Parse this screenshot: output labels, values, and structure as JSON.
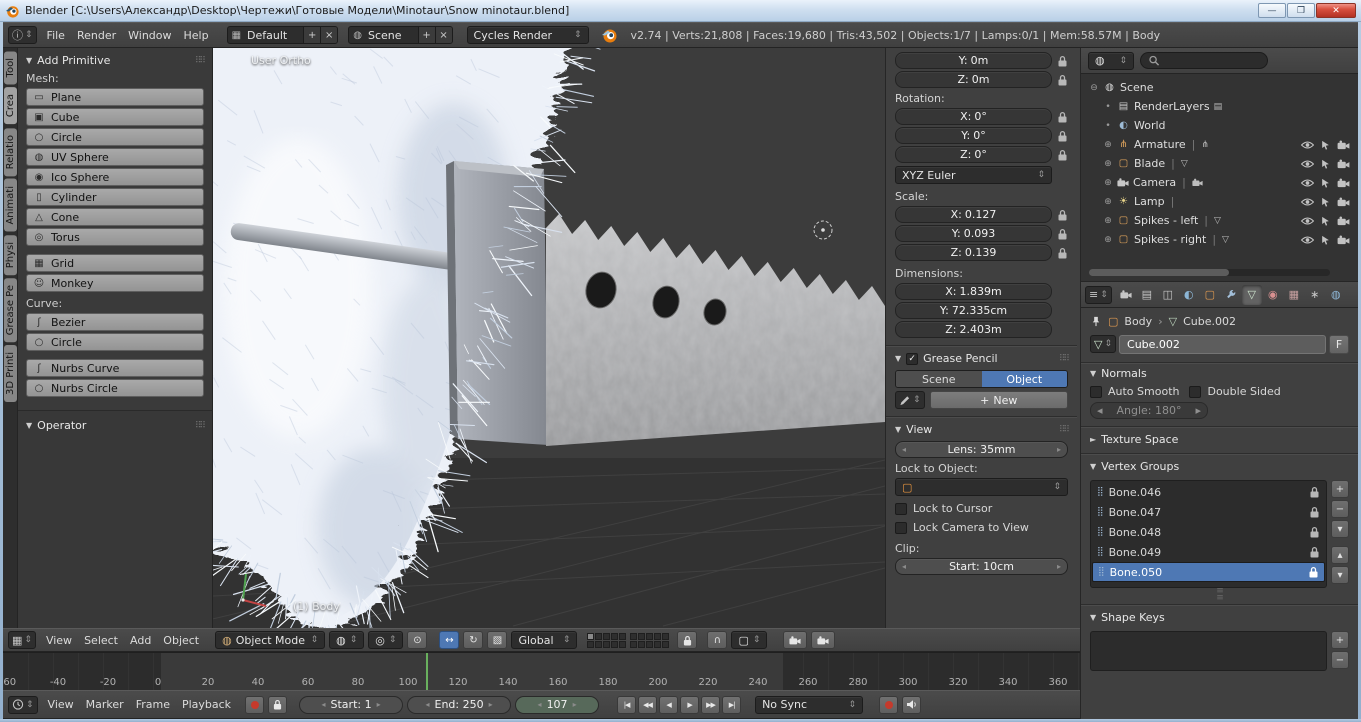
{
  "colors": {
    "accent": "#4e78b4",
    "green": "#69b05e",
    "red": "#c53a2c",
    "orange": "#e87d0d"
  },
  "window": {
    "title": "Blender [C:\\Users\\Александр\\Desktop\\Чертежи\\Готовые Модели\\Minotaur\\Snow minotaur.blend]"
  },
  "infobar": {
    "menus": [
      "File",
      "Render",
      "Window",
      "Help"
    ],
    "screen_name": "Default",
    "scene_name": "Scene",
    "engine": "Cycles Render",
    "stats": "v2.74 | Verts:21,808 | Faces:19,680 | Tris:43,502 | Objects:1/7 | Lamps:0/1 | Mem:58.57M | Body"
  },
  "toolshelf": {
    "tabs": [
      {
        "label": "Tool",
        "active": false
      },
      {
        "label": "Crea",
        "active": true
      },
      {
        "label": "Relatio",
        "active": false
      },
      {
        "label": "Animati",
        "active": false
      },
      {
        "label": "Physi",
        "active": false
      },
      {
        "label": "Grease Pe",
        "active": false
      },
      {
        "label": "3D Printi",
        "active": false
      }
    ],
    "panel_title": "Add Primitive",
    "mesh_label": "Mesh:",
    "mesh_buttons": [
      {
        "icon": "▭",
        "label": "Plane"
      },
      {
        "icon": "▣",
        "label": "Cube"
      },
      {
        "icon": "○",
        "label": "Circle"
      },
      {
        "icon": "◍",
        "label": "UV Sphere"
      },
      {
        "icon": "◉",
        "label": "Ico Sphere"
      },
      {
        "icon": "▯",
        "label": "Cylinder"
      },
      {
        "icon": "△",
        "label": "Cone"
      },
      {
        "icon": "◎",
        "label": "Torus"
      }
    ],
    "mesh_buttons2": [
      {
        "icon": "▦",
        "label": "Grid"
      },
      {
        "icon": "☺",
        "label": "Monkey"
      }
    ],
    "curve_label": "Curve:",
    "curve_buttons": [
      {
        "icon": "ʃ",
        "label": "Bezier"
      },
      {
        "icon": "○",
        "label": "Circle"
      }
    ],
    "curve_buttons2": [
      {
        "icon": "ʃ",
        "label": "Nurbs Curve"
      },
      {
        "icon": "○",
        "label": "Nurbs Circle"
      }
    ],
    "operator_title": "Operator"
  },
  "viewport": {
    "view_label": "User Ortho",
    "object_label": "(1) Body"
  },
  "npanel": {
    "loc_fields": [
      {
        "label": "Y:",
        "value": "0m"
      },
      {
        "label": "Z:",
        "value": "0m"
      }
    ],
    "rotation_label": "Rotation:",
    "rot_fields": [
      {
        "label": "X:",
        "value": "0°"
      },
      {
        "label": "Y:",
        "value": "0°"
      },
      {
        "label": "Z:",
        "value": "0°"
      }
    ],
    "rotation_mode": "XYZ Euler",
    "scale_label": "Scale:",
    "scale_fields": [
      {
        "label": "X:",
        "value": "0.127"
      },
      {
        "label": "Y:",
        "value": "0.093"
      },
      {
        "label": "Z:",
        "value": "0.139"
      }
    ],
    "dimensions_label": "Dimensions:",
    "dim_fields": [
      {
        "label": "X:",
        "value": "1.839m"
      },
      {
        "label": "Y:",
        "value": "72.335cm"
      },
      {
        "label": "Z:",
        "value": "2.403m"
      }
    ],
    "grease_title": "Grease Pencil",
    "gp_scene": "Scene",
    "gp_object": "Object",
    "gp_new": "New",
    "view_title": "View",
    "lens_label": "Lens:",
    "lens_value": "35mm",
    "lock_object_label": "Lock to Object:",
    "lock_cursor_label": "Lock to Cursor",
    "lock_camera_label": "Lock Camera to View",
    "clip_label": "Clip:",
    "clip_start_label": "Start:",
    "clip_start_value": "10cm"
  },
  "outliner": {
    "scene_label": "Scene",
    "items": [
      {
        "name": "RenderLayers",
        "icon": "layers_img",
        "color": "#cccccc",
        "expand": false,
        "pipe": false,
        "badge": "layers_img",
        "object": false
      },
      {
        "name": "World",
        "icon": "world",
        "color": "#9dbbd6",
        "expand": false,
        "pipe": false,
        "badge": "",
        "object": false
      },
      {
        "name": "Armature",
        "icon": "armature",
        "color": "#e0a45c",
        "expand": true,
        "pipe": true,
        "badge": "armature",
        "object": true
      },
      {
        "name": "Blade",
        "icon": "object_cube",
        "color": "#e0a45c",
        "expand": true,
        "pipe": true,
        "badge": "mesh_tri",
        "object": true
      },
      {
        "name": "Camera",
        "icon": "camera",
        "color": "#c8c8c8",
        "expand": true,
        "pipe": true,
        "badge": "camera",
        "object": true
      },
      {
        "name": "Lamp",
        "icon": "lamp",
        "color": "#e8d48a",
        "expand": true,
        "pipe": true,
        "badge": "",
        "object": true
      },
      {
        "name": "Spikes - left",
        "icon": "object_cube",
        "color": "#e0a45c",
        "expand": true,
        "pipe": true,
        "badge": "mesh_tri",
        "object": true
      },
      {
        "name": "Spikes - right",
        "icon": "object_cube",
        "color": "#e0a45c",
        "expand": true,
        "pipe": true,
        "badge": "mesh_tri",
        "object": true
      }
    ]
  },
  "properties": {
    "breadcrumb_object": "Body",
    "breadcrumb_data": "Cube.002",
    "name_value": "Cube.002",
    "fake_user": "F",
    "normals_title": "Normals",
    "auto_smooth": "Auto Smooth",
    "double_sided": "Double Sided",
    "angle_label": "Angle:",
    "angle_value": "180°",
    "texture_space_title": "Texture Space",
    "vertex_groups_title": "Vertex Groups",
    "vgroups": [
      {
        "name": "Bone.046",
        "selected": false
      },
      {
        "name": "Bone.047",
        "selected": false
      },
      {
        "name": "Bone.048",
        "selected": false
      },
      {
        "name": "Bone.049",
        "selected": false
      },
      {
        "name": "Bone.050",
        "selected": true
      }
    ],
    "shape_keys_title": "Shape Keys"
  },
  "vpheader": {
    "menus": [
      "View",
      "Select",
      "Add",
      "Object"
    ],
    "mode": "Object Mode",
    "orientation": "Global"
  },
  "timeline": {
    "labels": [
      "-60",
      "-40",
      "-20",
      "0",
      "20",
      "40",
      "60",
      "80",
      "100",
      "120",
      "140",
      "160",
      "180",
      "200",
      "220",
      "240",
      "260",
      "280",
      "300",
      "320",
      "340",
      "360"
    ],
    "menus": [
      "View",
      "Marker",
      "Frame",
      "Playback"
    ],
    "start_label": "Start:",
    "start_value": "1",
    "end_label": "End:",
    "end_value": "250",
    "frame_value": "107",
    "frame_start": 1,
    "frame_end": 250,
    "current_frame": 107,
    "sync_label": "No Sync",
    "playback_icons": [
      "|◀",
      "◀◀",
      "◀",
      "▶",
      "▶▶",
      "▶|"
    ]
  },
  "icons": {
    "info": "ⓘ",
    "updown": "⇕",
    "screen": "▦",
    "scene_sel": "◍",
    "plus": "+",
    "x": "×",
    "panel_open": "▼",
    "panel_closed": "►",
    "dots": "⠿⠿",
    "check": "✓",
    "expand": "⊕",
    "collapse": "⊖",
    "dot": "•",
    "viewport_editor": "▦",
    "mode_sphere": "◍",
    "shading_sphere": "◍",
    "pivot": "◎",
    "center_points": "⊙",
    "translate": "↔",
    "rotate": "↻",
    "scale": "▧",
    "magnet": "∩",
    "snap_element": "▢",
    "object_cube": "▢",
    "mesh_tri": "▽",
    "world": "◐",
    "armature": "⋔",
    "lamp": "☀",
    "layers_img": "▤",
    "scene_icon": "◫",
    "material": "◉",
    "texture": "▦",
    "particles": "∗",
    "physics": "◍",
    "props_editor": "≡",
    "vgroup_grid": "⣿",
    "arrow_right": "›",
    "arrow_left": "◂",
    "arrow_rt": "▸"
  }
}
